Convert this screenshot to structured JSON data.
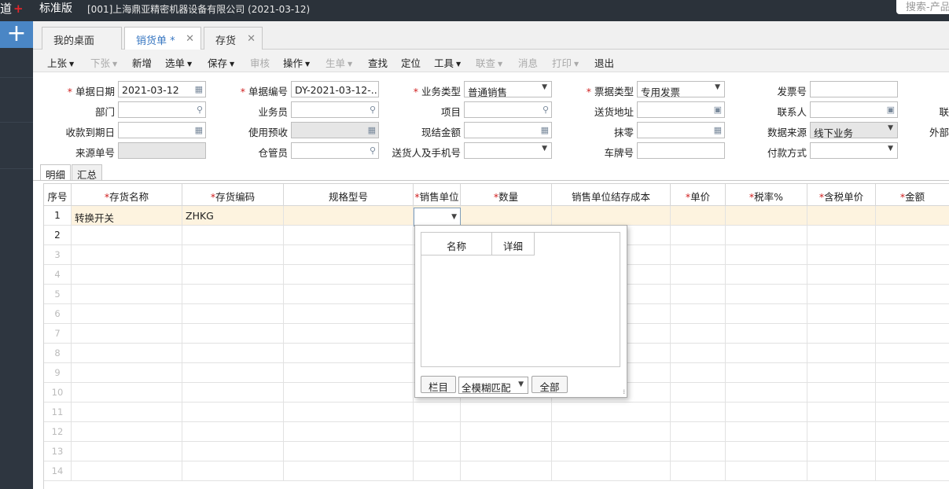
{
  "header": {
    "brand_glyph": "道",
    "brand_mark": "+",
    "edition": "标准版",
    "company": "[001]上海鼎亚精密机器设备有限公司    (2021-03-12)",
    "search_placeholder": "搜索-产品"
  },
  "rail": {
    "add_label": "+"
  },
  "tabs": [
    {
      "label": "我的桌面",
      "closable": false
    },
    {
      "label": "销货单 *",
      "closable": true
    },
    {
      "label": "存货",
      "closable": true
    }
  ],
  "tab_close": "✕",
  "toolbar": [
    {
      "label": "上张",
      "dropdown": true,
      "enabled": true
    },
    {
      "label": "下张",
      "dropdown": true,
      "enabled": false
    },
    {
      "label": "新增",
      "dropdown": false,
      "enabled": true
    },
    {
      "label": "选单",
      "dropdown": true,
      "enabled": true
    },
    {
      "label": "保存",
      "dropdown": true,
      "enabled": true
    },
    {
      "label": "审核",
      "dropdown": false,
      "enabled": false
    },
    {
      "label": "操作",
      "dropdown": true,
      "enabled": true
    },
    {
      "label": "生单",
      "dropdown": true,
      "enabled": false
    },
    {
      "label": "查找",
      "dropdown": false,
      "enabled": true
    },
    {
      "label": "定位",
      "dropdown": false,
      "enabled": true
    },
    {
      "label": "工具",
      "dropdown": true,
      "enabled": true
    },
    {
      "label": "联查",
      "dropdown": true,
      "enabled": false
    },
    {
      "label": "消息",
      "dropdown": false,
      "enabled": false
    },
    {
      "label": "打印",
      "dropdown": true,
      "enabled": false
    },
    {
      "label": "退出",
      "dropdown": false,
      "enabled": true
    }
  ],
  "form": {
    "bill_date": {
      "label": "单据日期",
      "value": "2021-03-12",
      "required": true
    },
    "bill_no": {
      "label": "单据编号",
      "value": "DY-2021-03-12-...",
      "required": true
    },
    "biz_type": {
      "label": "业务类型",
      "value": "普通销售",
      "required": true
    },
    "invoice_type": {
      "label": "票据类型",
      "value": "专用发票",
      "required": true
    },
    "invoice_no": {
      "label": "发票号",
      "value": ""
    },
    "department": {
      "label": "部门",
      "value": ""
    },
    "salesman": {
      "label": "业务员",
      "value": ""
    },
    "project": {
      "label": "项目",
      "value": ""
    },
    "ship_address": {
      "label": "送货地址",
      "value": ""
    },
    "contact": {
      "label": "联系人",
      "value": ""
    },
    "contact_cut": {
      "label": "联",
      "value": ""
    },
    "due_date": {
      "label": "收款到期日",
      "value": ""
    },
    "prepay": {
      "label": "使用预收",
      "value": ""
    },
    "cash_amount": {
      "label": "现结金额",
      "value": ""
    },
    "rounding": {
      "label": "抹零",
      "value": ""
    },
    "data_source": {
      "label": "数据来源",
      "value": "线下业务"
    },
    "external_cut": {
      "label": "外部",
      "value": ""
    },
    "source_no": {
      "label": "来源单号",
      "value": ""
    },
    "keeper": {
      "label": "仓管员",
      "value": ""
    },
    "deliverer": {
      "label": "送货人及手机号",
      "value": ""
    },
    "plate_no": {
      "label": "车牌号",
      "value": ""
    },
    "pay_method": {
      "label": "付款方式",
      "value": ""
    }
  },
  "icons": {
    "date": "▦",
    "search": "⚲",
    "dropdown": "▼",
    "address": "▣",
    "calc": "▦"
  },
  "detail_tabs": [
    "明细",
    "汇总"
  ],
  "grid": {
    "columns": [
      "序号",
      "存货名称",
      "存货编码",
      "规格型号",
      "销售单位",
      "数量",
      "销售单位结存成本",
      "单价",
      "税率%",
      "含税单价",
      "金额"
    ],
    "required_star": "*",
    "rows": [
      {
        "no": "1",
        "name": "转换开关",
        "code": "ZHKG"
      },
      {
        "no": "2",
        "name": "",
        "code": ""
      },
      {
        "no": "3",
        "name": "",
        "code": ""
      },
      {
        "no": "4",
        "name": "",
        "code": ""
      },
      {
        "no": "5",
        "name": "",
        "code": ""
      },
      {
        "no": "6",
        "name": "",
        "code": ""
      },
      {
        "no": "7",
        "name": "",
        "code": ""
      },
      {
        "no": "8",
        "name": "",
        "code": ""
      },
      {
        "no": "9",
        "name": "",
        "code": ""
      },
      {
        "no": "10",
        "name": "",
        "code": ""
      },
      {
        "no": "11",
        "name": "",
        "code": ""
      },
      {
        "no": "12",
        "name": "",
        "code": ""
      },
      {
        "no": "13",
        "name": "",
        "code": ""
      },
      {
        "no": "14",
        "name": "",
        "code": ""
      }
    ]
  },
  "popup": {
    "columns": [
      "名称",
      "详细"
    ],
    "buttons": {
      "columns": "栏目",
      "all": "全部"
    },
    "match_mode": "全模糊匹配",
    "grip": "⁞"
  }
}
